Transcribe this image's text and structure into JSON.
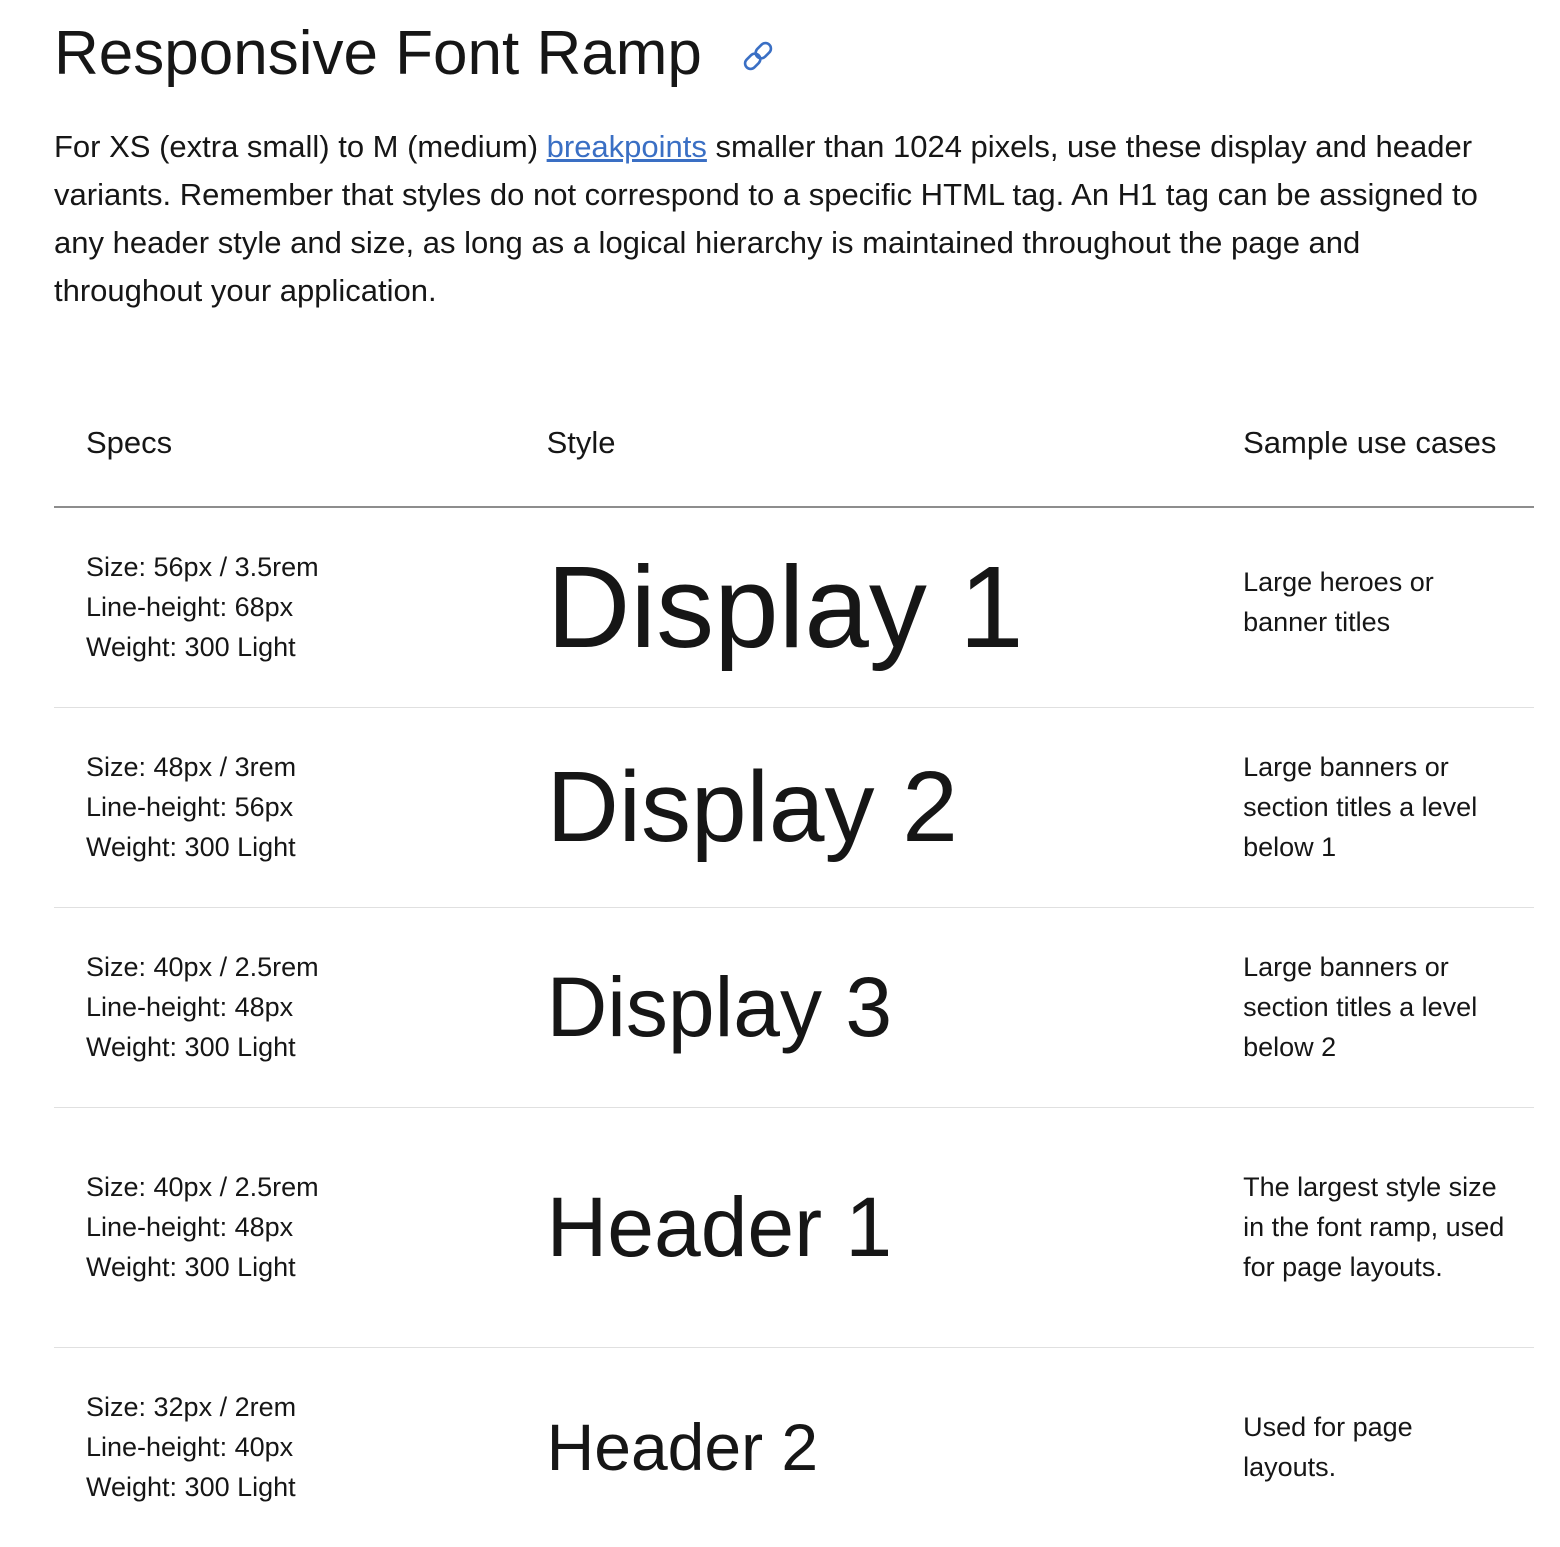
{
  "header": {
    "title": "Responsive Font Ramp",
    "anchor_icon": "link-icon",
    "link_color": "#3a6fc4"
  },
  "intro": {
    "before_link": "For XS (extra small) to M (medium) ",
    "link_text": "breakpoints",
    "after_link": " smaller than 1024 pixels, use these display and header variants. Remember that styles do not correspond to a specific HTML tag. An H1 tag can be assigned to any header style and size, as long as a logical hierarchy is maintained throughout the page and throughout your application."
  },
  "table": {
    "columns": [
      "Specs",
      "Style",
      "Sample use cases"
    ],
    "rows": [
      {
        "size": "Size: 56px / 3.5rem",
        "line_height": "Line-height: 68px",
        "weight": "Weight: 300 Light",
        "style": "Display 1",
        "use": "Large heroes or banner titles"
      },
      {
        "size": "Size: 48px / 3rem",
        "line_height": "Line-height: 56px",
        "weight": "Weight: 300 Light",
        "style": "Display 2",
        "use": "Large banners or section titles a level below 1"
      },
      {
        "size": "Size: 40px / 2.5rem",
        "line_height": "Line-height: 48px",
        "weight": "Weight: 300 Light",
        "style": "Display 3",
        "use": "Large banners or section titles a level below 2"
      },
      {
        "size": "Size: 40px / 2.5rem",
        "line_height": "Line-height: 48px",
        "weight": "Weight: 300 Light",
        "style": "Header 1",
        "use": "The largest style size in the font ramp, used for page layouts."
      },
      {
        "size": "Size: 32px / 2rem",
        "line_height": "Line-height: 40px",
        "weight": "Weight: 300 Light",
        "style": "Header 2",
        "use": "Used for page layouts."
      }
    ]
  }
}
